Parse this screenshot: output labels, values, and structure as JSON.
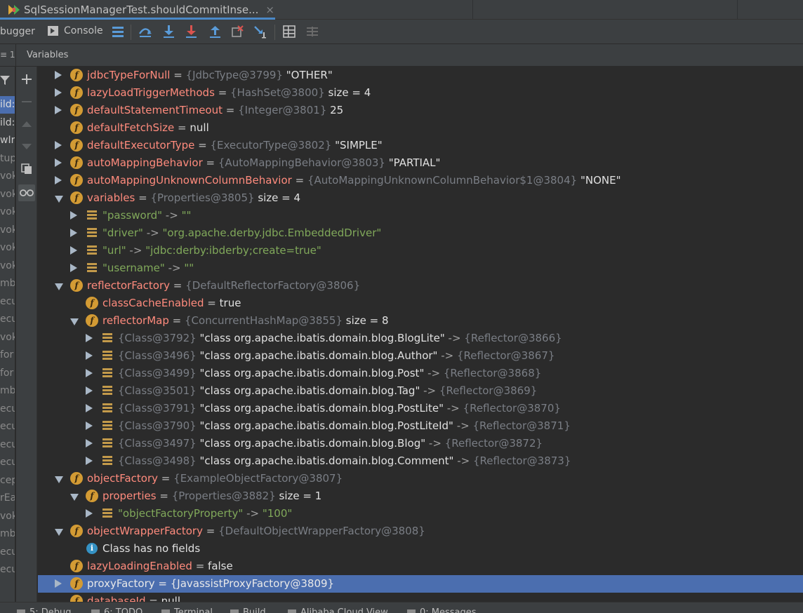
{
  "editor_tab": {
    "title": "SqlSessionManagerTest.shouldCommitInse...",
    "close_glyph": "×"
  },
  "toolbar": {
    "debugger_label": "bugger",
    "console_label": "Console",
    "icons": [
      "show-execution-point-icon",
      "step-over-icon",
      "step-into-icon",
      "force-step-into-icon",
      "step-out-icon",
      "drop-frame-icon",
      "run-to-cursor-icon",
      "evaluate-expression-icon",
      "trace-icon"
    ]
  },
  "subheader": {
    "frames_corner": "≡ 1",
    "variables_title": "Variables"
  },
  "frames_strip": [
    "ild:",
    "ild:",
    "wIr",
    "tup",
    "vok",
    "vok",
    "vok",
    "vok",
    "vok",
    "vok",
    "mbo",
    "ecu",
    "ecu",
    "vok",
    "for",
    "for",
    "mbo",
    "ecu",
    "ecu",
    "ecu",
    "ecu",
    "cep",
    "rEac",
    "vok",
    "mbo",
    "ecu",
    "ecu"
  ],
  "variables": [
    {
      "depth": 0,
      "arrow": "right",
      "icon": "field",
      "name": "jdbcTypeForNull",
      "type": "{JdbcType@3799}",
      "value": "\"OTHER\""
    },
    {
      "depth": 0,
      "arrow": "right",
      "icon": "field",
      "name": "lazyLoadTriggerMethods",
      "type": "{HashSet@3800}",
      "value": " size = 4"
    },
    {
      "depth": 0,
      "arrow": "right",
      "icon": "field",
      "name": "defaultStatementTimeout",
      "type": "{Integer@3801}",
      "value": "25"
    },
    {
      "depth": 0,
      "arrow": "none",
      "icon": "field",
      "name": "defaultFetchSize",
      "type": "",
      "value": "null"
    },
    {
      "depth": 0,
      "arrow": "right",
      "icon": "field",
      "name": "defaultExecutorType",
      "type": "{ExecutorType@3802}",
      "value": "\"SIMPLE\""
    },
    {
      "depth": 0,
      "arrow": "right",
      "icon": "field",
      "name": "autoMappingBehavior",
      "type": "{AutoMappingBehavior@3803}",
      "value": "\"PARTIAL\""
    },
    {
      "depth": 0,
      "arrow": "right",
      "icon": "field",
      "name": "autoMappingUnknownColumnBehavior",
      "type": "{AutoMappingUnknownColumnBehavior$1@3804}",
      "value": "\"NONE\""
    },
    {
      "depth": 0,
      "arrow": "down",
      "icon": "field",
      "name": "variables",
      "type": "{Properties@3805}",
      "value": " size = 4"
    },
    {
      "depth": 1,
      "arrow": "right",
      "icon": "map",
      "key": "\"password\"",
      "arrow_text": "->",
      "entry": "\"\""
    },
    {
      "depth": 1,
      "arrow": "right",
      "icon": "map",
      "key": "\"driver\"",
      "arrow_text": "->",
      "entry": "\"org.apache.derby.jdbc.EmbeddedDriver\""
    },
    {
      "depth": 1,
      "arrow": "right",
      "icon": "map",
      "key": "\"url\"",
      "arrow_text": "->",
      "entry": "\"jdbc:derby:ibderby;create=true\""
    },
    {
      "depth": 1,
      "arrow": "right",
      "icon": "map",
      "key": "\"username\"",
      "arrow_text": "->",
      "entry": "\"\""
    },
    {
      "depth": 0,
      "arrow": "down",
      "icon": "field",
      "name": "reflectorFactory",
      "type": "{DefaultReflectorFactory@3806}",
      "value": ""
    },
    {
      "depth": 1,
      "arrow": "none",
      "icon": "field",
      "name": "classCacheEnabled",
      "type": "",
      "value": "true"
    },
    {
      "depth": 1,
      "arrow": "down",
      "icon": "field",
      "name": "reflectorMap",
      "type": "{ConcurrentHashMap@3855}",
      "value": " size = 8"
    },
    {
      "depth": 2,
      "arrow": "right",
      "icon": "map",
      "ktype": "{Class@3792}",
      "key": "\"class org.apache.ibatis.domain.blog.BlogLite\"",
      "arrow_text": "->",
      "entry": "{Reflector@3866}"
    },
    {
      "depth": 2,
      "arrow": "right",
      "icon": "map",
      "ktype": "{Class@3496}",
      "key": "\"class org.apache.ibatis.domain.blog.Author\"",
      "arrow_text": "->",
      "entry": "{Reflector@3867}"
    },
    {
      "depth": 2,
      "arrow": "right",
      "icon": "map",
      "ktype": "{Class@3499}",
      "key": "\"class org.apache.ibatis.domain.blog.Post\"",
      "arrow_text": "->",
      "entry": "{Reflector@3868}"
    },
    {
      "depth": 2,
      "arrow": "right",
      "icon": "map",
      "ktype": "{Class@3501}",
      "key": "\"class org.apache.ibatis.domain.blog.Tag\"",
      "arrow_text": "->",
      "entry": "{Reflector@3869}"
    },
    {
      "depth": 2,
      "arrow": "right",
      "icon": "map",
      "ktype": "{Class@3791}",
      "key": "\"class org.apache.ibatis.domain.blog.PostLite\"",
      "arrow_text": "->",
      "entry": "{Reflector@3870}"
    },
    {
      "depth": 2,
      "arrow": "right",
      "icon": "map",
      "ktype": "{Class@3790}",
      "key": "\"class org.apache.ibatis.domain.blog.PostLiteId\"",
      "arrow_text": "->",
      "entry": "{Reflector@3871}"
    },
    {
      "depth": 2,
      "arrow": "right",
      "icon": "map",
      "ktype": "{Class@3497}",
      "key": "\"class org.apache.ibatis.domain.blog.Blog\"",
      "arrow_text": "->",
      "entry": "{Reflector@3872}"
    },
    {
      "depth": 2,
      "arrow": "right",
      "icon": "map",
      "ktype": "{Class@3498}",
      "key": "\"class org.apache.ibatis.domain.blog.Comment\"",
      "arrow_text": "->",
      "entry": "{Reflector@3873}"
    },
    {
      "depth": 0,
      "arrow": "down",
      "icon": "field",
      "name": "objectFactory",
      "type": "{ExampleObjectFactory@3807}",
      "value": ""
    },
    {
      "depth": 1,
      "arrow": "down",
      "icon": "field",
      "name": "properties",
      "type": "{Properties@3882}",
      "value": " size = 1"
    },
    {
      "depth": 2,
      "arrow": "right",
      "icon": "map",
      "key": "\"objectFactoryProperty\"",
      "arrow_text": "->",
      "entry": "\"100\""
    },
    {
      "depth": 0,
      "arrow": "down",
      "icon": "field",
      "name": "objectWrapperFactory",
      "type": "{DefaultObjectWrapperFactory@3808}",
      "value": ""
    },
    {
      "depth": 1,
      "arrow": "none",
      "icon": "info",
      "note": "Class has no fields"
    },
    {
      "depth": 0,
      "arrow": "none",
      "icon": "field",
      "name": "lazyLoadingEnabled",
      "type": "",
      "value": "false"
    },
    {
      "depth": 0,
      "arrow": "right",
      "icon": "field",
      "name": "proxyFactory",
      "type": "{JavassistProxyFactory@3809}",
      "value": "",
      "selected": true
    },
    {
      "depth": 0,
      "arrow": "none",
      "icon": "field",
      "name": "databaseId",
      "type": "",
      "value": "null"
    }
  ],
  "bottom_bar": [
    "5: Debug",
    "6: TODO",
    "Terminal",
    "Build",
    "Alibaba Cloud View",
    "0: Messages"
  ],
  "colors": {
    "accent": "#4a88c7",
    "selection": "#4b6eaf",
    "field_name": "#ff8b7d",
    "string": "#80a85a",
    "type_ref": "#7a7e85"
  }
}
